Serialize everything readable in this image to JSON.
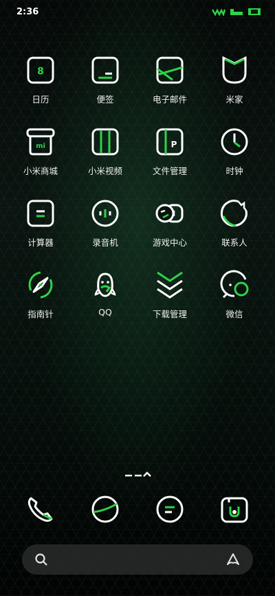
{
  "status_bar": {
    "time": "2:36",
    "icons": [
      "wifi-icon",
      "signal-icon",
      "battery-icon"
    ]
  },
  "colors": {
    "accent": "#2fd24a",
    "icon_stroke": "#ffffff",
    "background": "#060b09"
  },
  "apps": [
    {
      "label": "日历",
      "icon": "calendar-icon",
      "glyph": "8"
    },
    {
      "label": "便签",
      "icon": "notes-icon"
    },
    {
      "label": "电子邮件",
      "icon": "email-icon"
    },
    {
      "label": "米家",
      "icon": "mijia-icon"
    },
    {
      "label": "小米商城",
      "icon": "mi-store-icon",
      "glyph": "mi"
    },
    {
      "label": "小米视频",
      "icon": "mi-video-icon"
    },
    {
      "label": "文件管理",
      "icon": "file-manager-icon",
      "glyph": "P"
    },
    {
      "label": "时钟",
      "icon": "clock-icon"
    },
    {
      "label": "计算器",
      "icon": "calculator-icon"
    },
    {
      "label": "录音机",
      "icon": "recorder-icon"
    },
    {
      "label": "游戏中心",
      "icon": "game-center-icon"
    },
    {
      "label": "联系人",
      "icon": "contacts-icon"
    },
    {
      "label": "指南针",
      "icon": "compass-icon"
    },
    {
      "label": "QQ",
      "icon": "qq-icon"
    },
    {
      "label": "下载管理",
      "icon": "download-manager-icon"
    },
    {
      "label": "微信",
      "icon": "wechat-icon"
    }
  ],
  "dock": [
    {
      "icon": "phone-icon"
    },
    {
      "icon": "browser-icon"
    },
    {
      "icon": "messages-icon"
    },
    {
      "icon": "camera-icon"
    }
  ],
  "search": {
    "left_icon": "search-icon",
    "right_icon": "assistant-icon"
  }
}
